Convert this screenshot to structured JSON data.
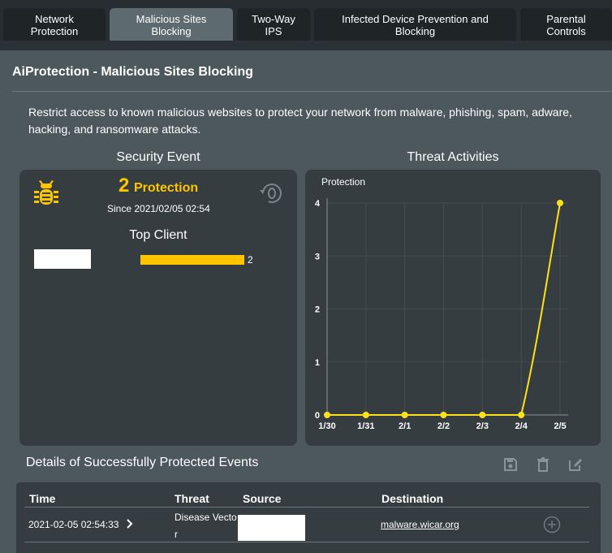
{
  "tabs": [
    {
      "label_1": "Network",
      "label_2": "Protection"
    },
    {
      "label_1": "Malicious Sites",
      "label_2": "Blocking"
    },
    {
      "label_1": "Two-Way",
      "label_2": "IPS"
    },
    {
      "label_1": "Infected Device Prevention and",
      "label_2": "Blocking"
    },
    {
      "label_1": "Parental",
      "label_2": "Controls"
    }
  ],
  "page": {
    "title": "AiProtection - Malicious Sites Blocking",
    "description": "Restrict access to known malicious websites to protect your network from malware, phishing, spam, adware, hacking, and ransomware attacks."
  },
  "security_event": {
    "title": "Security Event",
    "count": "2",
    "count_label": "Protection",
    "since": "Since 2021/02/05 02:54",
    "reset_icon": "reset-counter-icon",
    "top_client_title": "Top Client",
    "top_client": {
      "name": "",
      "count": "2"
    }
  },
  "threat_activities": {
    "title": "Threat Activities"
  },
  "chart_data": {
    "type": "line",
    "title": "",
    "series": [
      {
        "name": "Protection",
        "values": [
          0,
          0,
          0,
          0,
          0,
          0,
          4
        ]
      }
    ],
    "categories": [
      "1/30",
      "1/31",
      "2/1",
      "2/2",
      "2/3",
      "2/4",
      "2/5"
    ],
    "y_ticks": [
      "0",
      "1",
      "2",
      "3",
      "4"
    ],
    "ylim": [
      0,
      4
    ],
    "grid": true,
    "color": "#ffe11a",
    "xlabel": "",
    "ylabel": ""
  },
  "details": {
    "title": "Details of Successfully Protected Events",
    "tools": [
      "save-icon",
      "trash-icon",
      "edit-icon"
    ],
    "columns": {
      "time": "Time",
      "threat": "Threat",
      "source": "Source",
      "destination": "Destination"
    },
    "rows": [
      {
        "time": "2021-02-05 02:54:33",
        "threat_1": "Disease Vecto",
        "threat_2": "r",
        "source": "",
        "destination": "malware.wicar.org"
      }
    ]
  },
  "colors": {
    "accent": "#ffc600",
    "chart_line": "#ffe11a",
    "background": "#4d585d",
    "card": "#353d40"
  }
}
